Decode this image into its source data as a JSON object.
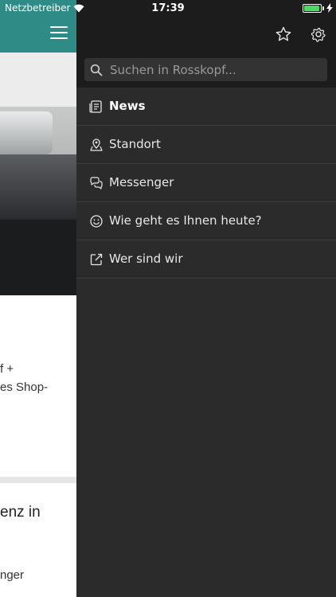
{
  "status_bar": {
    "carrier": "Netzbetreiber",
    "time": "17:39",
    "battery_level": 0.95,
    "battery_color": "#4cd964"
  },
  "background_app": {
    "header_color": "#2f8b86",
    "text_snippet_lines": [
      "f +",
      "es Shop-"
    ],
    "heading_snippet": "enz in",
    "bottom_snippet": "nger"
  },
  "drawer": {
    "top_icons": [
      "star-icon",
      "gear-icon"
    ],
    "search": {
      "placeholder": "Suchen in Rosskopf..."
    },
    "menu": [
      {
        "label": "News",
        "icon": "newspaper-icon",
        "active": true
      },
      {
        "label": "Standort",
        "icon": "map-pin-icon",
        "active": false
      },
      {
        "label": "Messenger",
        "icon": "chat-bubbles-icon",
        "active": false
      },
      {
        "label": "Wie geht es Ihnen heute?",
        "icon": "smiley-icon",
        "active": false
      },
      {
        "label": "Wer sind wir",
        "icon": "external-link-icon",
        "active": false
      }
    ]
  }
}
